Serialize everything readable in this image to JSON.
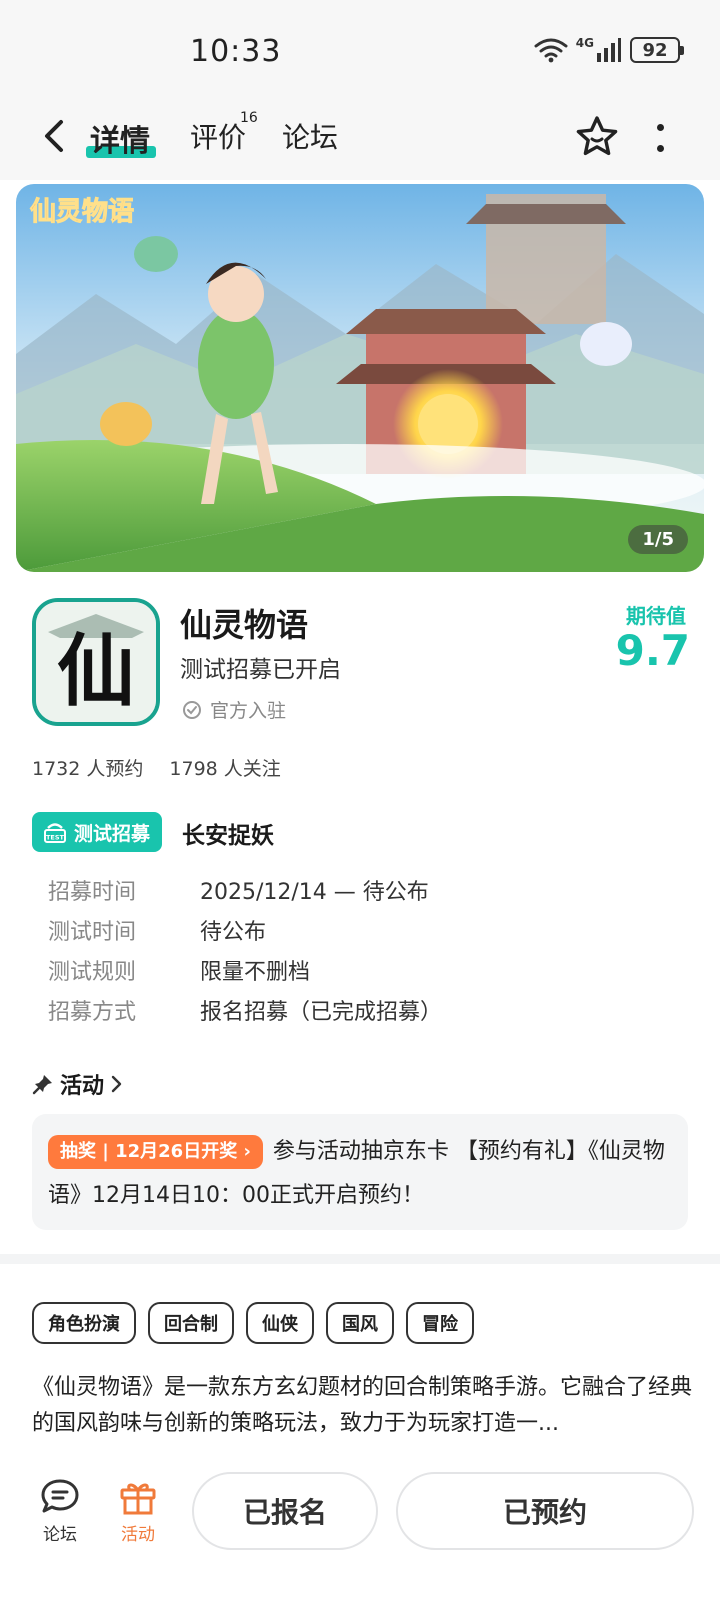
{
  "status_bar": {
    "time": "10:33",
    "network": "4G",
    "battery": "92"
  },
  "nav": {
    "tabs": [
      {
        "label": "详情",
        "active": true
      },
      {
        "label": "评价",
        "badge": "16"
      },
      {
        "label": "论坛"
      }
    ],
    "icons": [
      "back-icon",
      "star-icon",
      "more-icon"
    ]
  },
  "banner": {
    "counter": "1/5",
    "logo_text": "仙灵物语"
  },
  "app": {
    "icon_char": "仙",
    "title": "仙灵物语",
    "subtitle": "测试招募已开启",
    "official": "官方入驻",
    "expect_label": "期待值",
    "expect_value": "9.7",
    "stats": {
      "reservations": "1732 人预约",
      "follows": "1798 人关注"
    }
  },
  "test": {
    "badge": "测试招募",
    "badge_icon_text": "TEST",
    "name": "长安捉妖",
    "rows": [
      {
        "label": "招募时间",
        "value": "2025/12/14 — 待公布"
      },
      {
        "label": "测试时间",
        "value": "待公布"
      },
      {
        "label": "测试规则",
        "value": "限量不删档"
      },
      {
        "label": "招募方式",
        "value": "报名招募（已完成招募）"
      }
    ]
  },
  "activity": {
    "header": "活动",
    "chip": "抽奖 | 12月26日开奖",
    "text": "参与活动抽京东卡 【预约有礼】《仙灵物语》12月14日10：00正式开启预约！"
  },
  "tags": [
    "角色扮演",
    "回合制",
    "仙侠",
    "国风",
    "冒险"
  ],
  "description": "《仙灵物语》是一款东方玄幻题材的回合制策略手游。它融合了经典的国风韵味与创新的策略玩法，致力于为玩家打造一...",
  "bottom_bar": {
    "forum_label": "论坛",
    "activity_label": "活动",
    "signed_label": "已报名",
    "reserved_label": "已预约"
  },
  "colors": {
    "accent": "#19c4ad",
    "orange": "#ff7a3d"
  }
}
